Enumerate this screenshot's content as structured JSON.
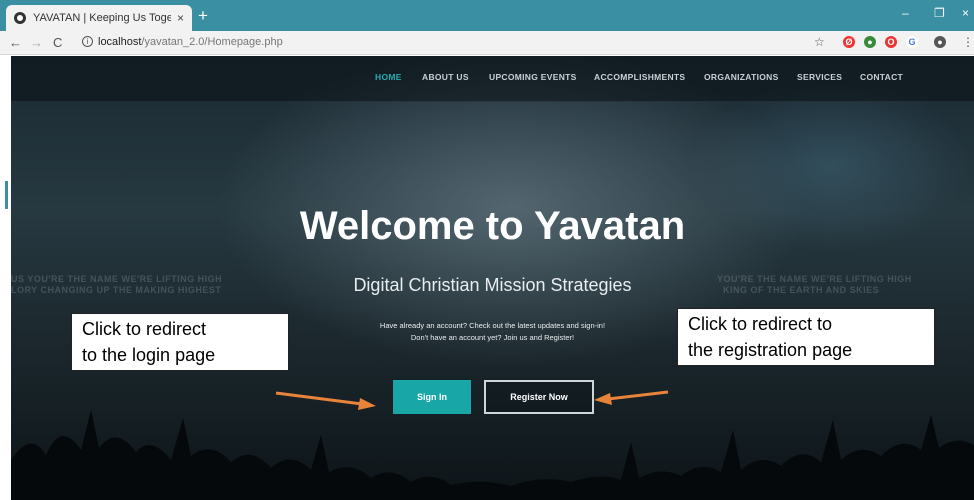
{
  "browser": {
    "tab_title": "YAVATAN | Keeping Us Together",
    "tab_close": "×",
    "new_tab": "+",
    "url_host": "localhost",
    "url_path": "/yavatan_2.0/Homepage.php",
    "accent": "#3b8fa3"
  },
  "nav": {
    "items": [
      {
        "label": "HOME"
      },
      {
        "label": "ABOUT US"
      },
      {
        "label": "UPCOMING EVENTS"
      },
      {
        "label": "ACCOMPLISHMENTS"
      },
      {
        "label": "ORGANIZATIONS"
      },
      {
        "label": "SERVICES"
      },
      {
        "label": "CONTACT"
      }
    ],
    "active_color": "#2aa9b0"
  },
  "background_text": {
    "left_line1": "US YOU'RE THE NAME WE'RE LIFTING HIGH",
    "left_line2": "LORY CHANGING UP THE MAKING HIGHEST",
    "right_line1": "YOU'RE THE NAME WE'RE LIFTING HIGH",
    "right_line2": "KING OF THE EARTH AND SKIES"
  },
  "hero": {
    "title": "Welcome to Yavatan",
    "subtitle": "Digital Christian Mission Strategies",
    "message_line1": "Have already an account? Check out the latest updates and sign-in!",
    "message_line2": "Don't have an account yet? Join us and Register!"
  },
  "buttons": {
    "signin": "Sign In",
    "register": "Register Now",
    "signin_color": "#18a7a6"
  },
  "annotations": {
    "left_line1": "Click to redirect",
    "left_line2": "to the login page",
    "right_line1": "Click to redirect to",
    "right_line2": "the registration page",
    "arrow_color": "#e8843a"
  }
}
